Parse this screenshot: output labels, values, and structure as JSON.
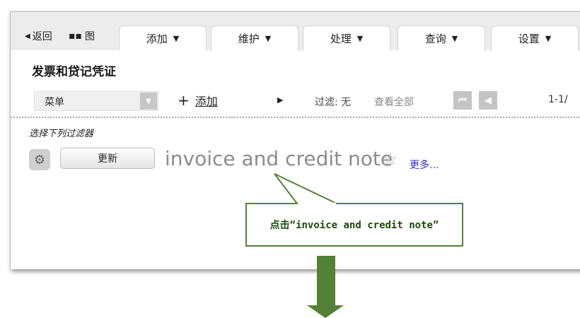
{
  "toolbar": {
    "back_label": "返回",
    "grid_label": "图"
  },
  "tabs": [
    {
      "label": "添加"
    },
    {
      "label": "维护"
    },
    {
      "label": "处理"
    },
    {
      "label": "查询"
    },
    {
      "label": "设置"
    }
  ],
  "page": {
    "title": "发票和贷记凭证"
  },
  "controls": {
    "menu_select": "菜单",
    "add_label": "添加",
    "filter_label": "过滤: 无",
    "view_all": "查看全部",
    "page_count": "1-1/"
  },
  "filters": {
    "hint": "选择下列过滤器",
    "refresh_label": "更新",
    "filter_name": "invoice and credit note",
    "more_label": "更多..."
  },
  "callout": {
    "text": "点击“invoice and credit note”",
    "color": "#538135",
    "arrow_color": "#538135"
  }
}
